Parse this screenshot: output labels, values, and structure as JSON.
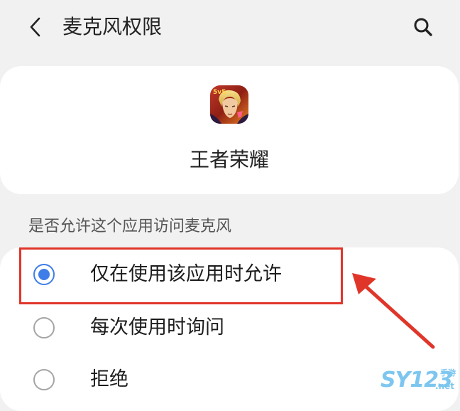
{
  "header": {
    "back_icon": "chevron-left-icon",
    "title": "麦克风权限",
    "search_icon": "search-icon"
  },
  "app": {
    "name": "王者荣耀",
    "icon": "game-app-icon"
  },
  "permission": {
    "question": "是否允许这个应用访问麦克风",
    "options": [
      {
        "label": "仅在使用该应用时允许",
        "selected": true
      },
      {
        "label": "每次使用时询问",
        "selected": false
      },
      {
        "label": "拒绝",
        "selected": false
      }
    ]
  },
  "watermark": {
    "main": "SY123",
    "sub": "手游",
    "domain": ".net"
  },
  "colors": {
    "background": "#f1f1f1",
    "card": "#ffffff",
    "accent": "#3f7ee8",
    "annotation": "#e0362a",
    "watermark": "#7dc6ef"
  }
}
